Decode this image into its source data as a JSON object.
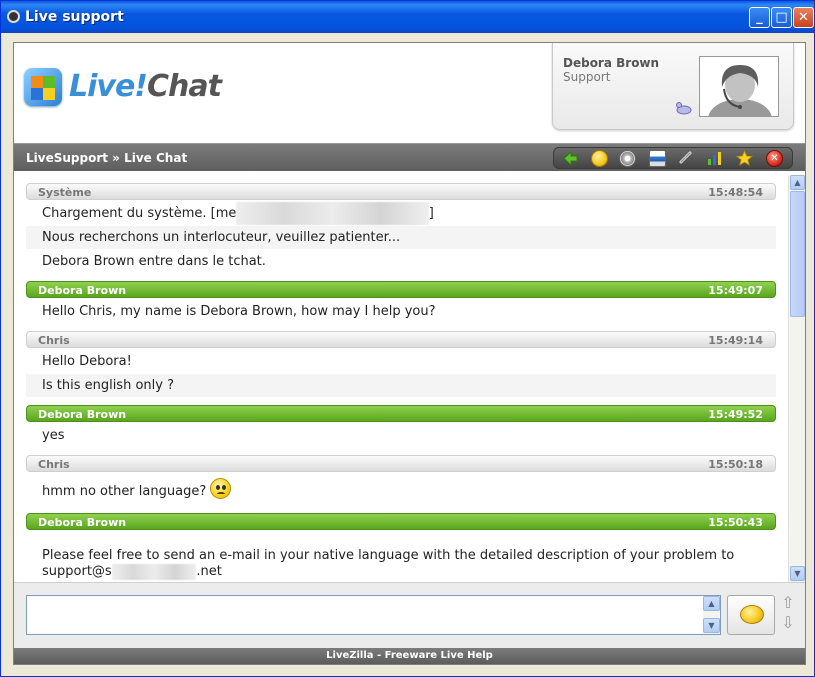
{
  "window": {
    "title": "Live support"
  },
  "logo": {
    "part1": "Live!",
    "part2": "Chat"
  },
  "agent": {
    "name": "Debora Brown",
    "role": "Support"
  },
  "nav": {
    "breadcrumb": "LiveSupport » Live Chat"
  },
  "toolbar_icons": [
    "back-icon",
    "smiley-icon",
    "sound-icon",
    "print-icon",
    "link-icon",
    "chart-icon",
    "star-icon",
    "close-chat-icon"
  ],
  "messages": {
    "h1": {
      "who": "Système",
      "time": "15:48:54"
    },
    "l1_pre": "Chargement du système. [me",
    "l1_post": "]",
    "l2": "Nous recherchons un interlocuteur, veuillez patienter...",
    "l3": "Debora Brown entre dans le tchat.",
    "h2": {
      "who": "Debora Brown",
      "time": "15:49:07"
    },
    "l4": "Hello Chris, my name is Debora Brown, how may I help you?",
    "h3": {
      "who": "Chris",
      "time": "15:49:14"
    },
    "l5": "Hello Debora!",
    "l6": "Is this english only ?",
    "h4": {
      "who": "Debora Brown",
      "time": "15:49:52"
    },
    "l7": "yes",
    "h5": {
      "who": "Chris",
      "time": "15:50:18"
    },
    "l8": "hmm no other language?",
    "h6": {
      "who": "Debora Brown",
      "time": "15:50:43"
    },
    "l9": "Please feel free to send an e-mail in your native language with the detailed description of your problem to",
    "l10_pre": "support@s",
    "l10_post": ".net"
  },
  "input": {
    "value": ""
  },
  "footer": "LiveZilla - Freeware Live Help"
}
